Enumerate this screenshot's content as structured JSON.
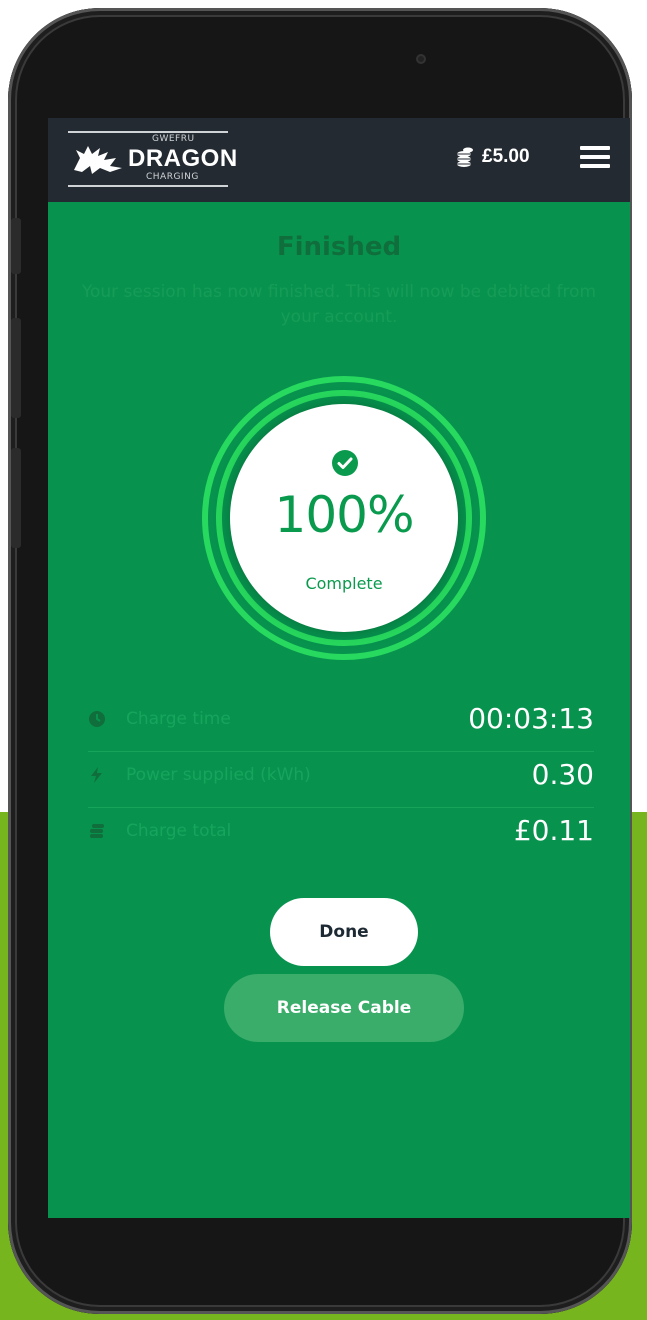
{
  "header": {
    "logo_top": "GWEFRU",
    "logo_main": "DRAGON",
    "logo_bottom": "CHARGING",
    "balance": "£5.00"
  },
  "session": {
    "title": "Finished",
    "message": "Your session has now finished. This will now be debited from your account.",
    "progress_value": "100%",
    "progress_label": "Complete",
    "progress_fraction": 1.0
  },
  "stats": [
    {
      "label": "Charge time",
      "value": "00:03:13",
      "icon": "clock-icon"
    },
    {
      "label": "Power supplied (kWh)",
      "value": "0.30",
      "icon": "bolt-icon"
    },
    {
      "label": "Charge total",
      "value": "£0.11",
      "icon": "coins-icon"
    }
  ],
  "actions": {
    "done_label": "Done",
    "release_label": "Release Cable"
  },
  "colors": {
    "screen_bg": "#07934e",
    "navbar_bg": "#232a31",
    "ring": "#27d95e",
    "background_accent": "#76b51d"
  }
}
